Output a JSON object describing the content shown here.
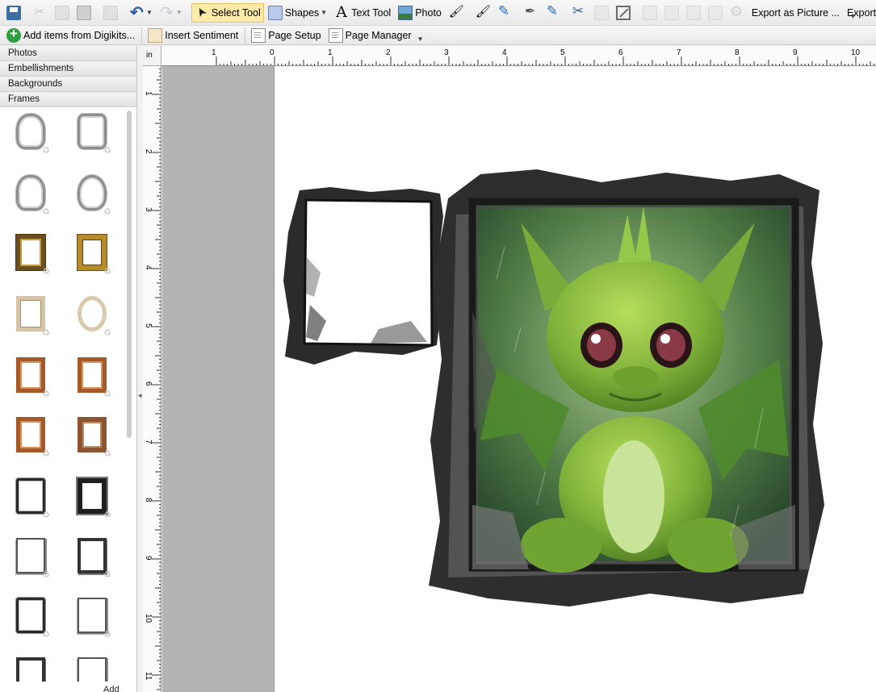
{
  "toolbar": {
    "select_tool": "Select Tool",
    "shapes": "Shapes",
    "text_tool": "Text Tool",
    "photo": "Photo",
    "export_picture": "Export as Picture ...",
    "export_pdf": "Export as PDF..."
  },
  "toolbar2": {
    "add_items": "Add items from Digikits...",
    "insert_sentiment": "Insert Sentiment",
    "page_setup": "Page Setup",
    "page_manager": "Page Manager"
  },
  "panel": {
    "categories": [
      "Photos",
      "Embellishments",
      "Backgrounds",
      "Frames"
    ],
    "add_label": "Add"
  },
  "ruler": {
    "unit": "in",
    "h_labels": [
      "1",
      "0",
      "1",
      "2",
      "3",
      "4",
      "5",
      "6",
      "7",
      "8",
      "9",
      "10"
    ],
    "v_labels": [
      "1",
      "2",
      "3",
      "4",
      "5",
      "6",
      "7",
      "8",
      "9",
      "10",
      "11"
    ]
  },
  "colors": {
    "active_tool": "#fde9a8",
    "canvas_margin": "#b4b4b4",
    "dragon_green": "#7fb23a"
  },
  "icons": [
    "save-icon",
    "cut-icon",
    "copy-icon",
    "paste-icon",
    "format-painter-icon",
    "undo-icon",
    "redo-icon",
    "select-cursor-icon",
    "shapes-icon",
    "text-icon",
    "photo-icon",
    "magic-wand-icon",
    "brush-icon",
    "highlighter-icon",
    "pen-icon",
    "pencil-icon",
    "scissors-icon",
    "eraser-icon",
    "crop-icon",
    "gear-icon",
    "add-icon",
    "book-icon",
    "page-icon"
  ]
}
